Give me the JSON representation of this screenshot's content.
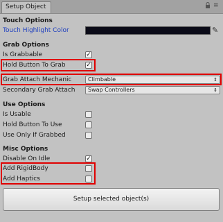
{
  "window": {
    "tab_title": "Setup Object",
    "lock_icon": "lock-icon",
    "menu_icon": "menu-icon"
  },
  "touch_options": {
    "header": "Touch Options",
    "highlight_color_label": "Touch Highlight Color",
    "highlight_color": "#0b0b18",
    "picker_icon": "eyedropper-icon"
  },
  "grab_options": {
    "header": "Grab Options",
    "is_grabbable": {
      "label": "Is Grabbable",
      "checked": true
    },
    "hold_button_to_grab": {
      "label": "Hold Button To Grab",
      "checked": true
    },
    "grab_attach_mechanic": {
      "label": "Grab Attach Mechanic",
      "value": "Climbable"
    },
    "secondary_grab_attach": {
      "label": "Secondary Grab Attach",
      "value": "Swap Controllers"
    }
  },
  "use_options": {
    "header": "Use Options",
    "is_usable": {
      "label": "Is Usable",
      "checked": false
    },
    "hold_button_to_use": {
      "label": "Hold Button To Use",
      "checked": false
    },
    "use_only_if_grabbed": {
      "label": "Use Only If Grabbed",
      "checked": false
    }
  },
  "misc_options": {
    "header": "Misc Options",
    "disable_on_idle": {
      "label": "Disable On Idle",
      "checked": true
    },
    "add_rigidbody": {
      "label": "Add RigidBody",
      "checked": false
    },
    "add_haptics": {
      "label": "Add Haptics",
      "checked": false
    }
  },
  "setup_button": {
    "label": "Setup selected object(s)"
  },
  "colors": {
    "highlight_box": "#e00000",
    "link_blue": "#1e3fbf"
  }
}
